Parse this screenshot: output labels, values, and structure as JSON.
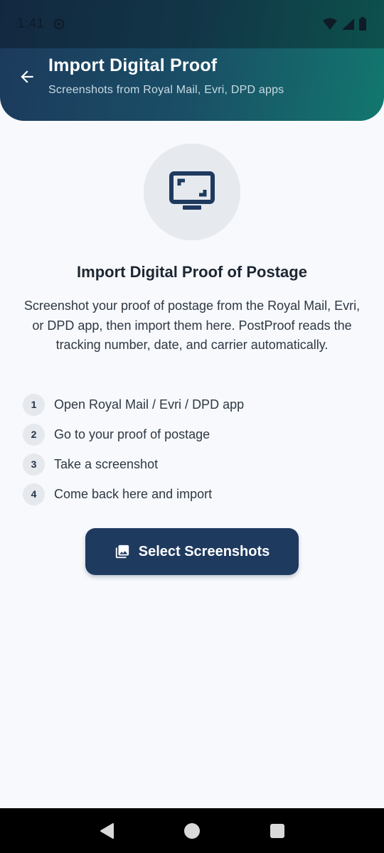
{
  "status_bar": {
    "time": "1:41"
  },
  "app_bar": {
    "title": "Import Digital Proof",
    "subtitle": "Screenshots from Royal Mail, Evri, DPD apps",
    "back_icon": "arrow-left-icon"
  },
  "hero": {
    "icon": "screenshot-monitor-icon",
    "title": "Import Digital Proof of Postage",
    "description": "Screenshot your proof of postage from the Royal Mail, Evri, or DPD app, then import them here. PostProof reads the tracking number, date, and carrier automatically."
  },
  "steps": [
    {
      "number": "1",
      "label": "Open Royal Mail / Evri / DPD app"
    },
    {
      "number": "2",
      "label": "Go to your proof of postage"
    },
    {
      "number": "3",
      "label": "Take a screenshot"
    },
    {
      "number": "4",
      "label": "Come back here and import"
    }
  ],
  "action": {
    "label": "Select Screenshots",
    "icon": "photo-library-icon"
  },
  "colors": {
    "header_start": "#1c3a5c",
    "header_end": "#12776e",
    "primary": "#1f3a5f",
    "background": "#f7f9fc"
  }
}
